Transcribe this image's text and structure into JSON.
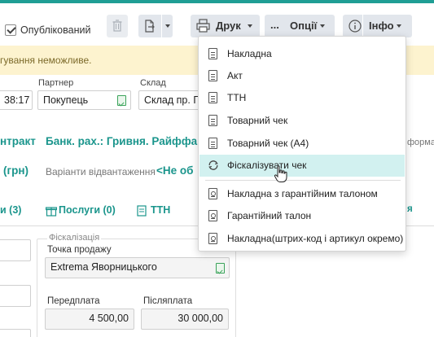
{
  "toolbar": {
    "published_label": "Опублікований",
    "published_checked": true,
    "print_label": "Друк",
    "options_label": "Опції",
    "options_prefix": "...",
    "info_label": "Інфо"
  },
  "warning": {
    "text": "гування неможливе."
  },
  "fields": {
    "time_value": "38:17",
    "partner_label": "Партнер",
    "partner_value": "Покупець",
    "warehouse_label": "Склад",
    "warehouse_value": "Склад пр. По"
  },
  "info_row": {
    "contract": "нтракт",
    "bank": "Банк. рах.: Гривня. Райффа",
    "right_fragment": "форма",
    "currency": "(грн)",
    "shipping_label": "Варіанти відвантаження",
    "shipping_value": "<Не об"
  },
  "tabs": [
    {
      "label": "и (3)"
    },
    {
      "label": "Послуги (0)"
    },
    {
      "label": "ТТН"
    },
    {
      "label": "я"
    }
  ],
  "fiscal": {
    "title": "Фіскалізація",
    "sale_point_label": "Точка продажу",
    "sale_point_value": "Extrema Яворницького",
    "prepay_label": "Передплата",
    "prepay_value": "4 500,00",
    "postpay_label": "Післяплата",
    "postpay_value": "30 000,00"
  },
  "print_menu": {
    "items": [
      {
        "label": "Накладна",
        "icon": "document-icon"
      },
      {
        "label": "Акт",
        "icon": "document-icon"
      },
      {
        "label": "ТТН",
        "icon": "document-icon"
      },
      {
        "label": "Товарний чек",
        "icon": "document-icon"
      },
      {
        "label": "Товарний чек (А4)",
        "icon": "document-icon"
      },
      {
        "label": "Фіскалізувати чек",
        "icon": "refresh-icon",
        "highlighted": true
      },
      {
        "label": "Накладна з гарантійним талоном",
        "icon": "certificate-icon"
      },
      {
        "label": "Гарантійний талон",
        "icon": "certificate-icon"
      },
      {
        "label": "Накладна(штрих-код і артикул окремо)",
        "icon": "certificate-icon"
      }
    ]
  },
  "colors": {
    "accent": "#1a958c",
    "highlight": "#d2f1f0",
    "warning_bg": "#fdf3cf"
  }
}
